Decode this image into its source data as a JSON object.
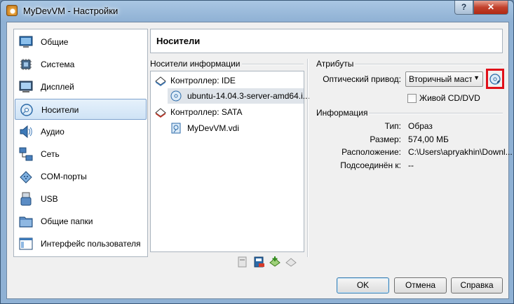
{
  "window": {
    "title": "MyDevVM - Настройки",
    "help_label": "?",
    "close_label": "✕"
  },
  "sidebar": {
    "items": [
      {
        "label": "Общие",
        "icon": "general-icon"
      },
      {
        "label": "Система",
        "icon": "system-icon"
      },
      {
        "label": "Дисплей",
        "icon": "display-icon"
      },
      {
        "label": "Носители",
        "icon": "storage-icon",
        "selected": true
      },
      {
        "label": "Аудио",
        "icon": "audio-icon"
      },
      {
        "label": "Сеть",
        "icon": "network-icon"
      },
      {
        "label": "COM-порты",
        "icon": "serial-ports-icon"
      },
      {
        "label": "USB",
        "icon": "usb-icon"
      },
      {
        "label": "Общие папки",
        "icon": "shared-folders-icon"
      },
      {
        "label": "Интерфейс пользователя",
        "icon": "user-interface-icon"
      }
    ]
  },
  "page": {
    "title": "Носители"
  },
  "storage": {
    "section_title": "Носители информации",
    "tree": [
      {
        "label": "Контроллер: IDE",
        "type": "controller"
      },
      {
        "label": "ubuntu-14.04.3-server-amd64.i...",
        "type": "optical",
        "selected": true
      },
      {
        "label": "Контроллер: SATA",
        "type": "controller"
      },
      {
        "label": "MyDevVM.vdi",
        "type": "disk"
      }
    ]
  },
  "attributes": {
    "section_title": "Атрибуты",
    "drive_label": "Оптический привод:",
    "drive_value": "Вторичный мастер",
    "live_cd_label": "Живой CD/DVD",
    "live_cd_checked": false
  },
  "info": {
    "section_title": "Информация",
    "rows": [
      {
        "label": "Тип:",
        "value": "Образ"
      },
      {
        "label": "Размер:",
        "value": "574,00 МБ"
      },
      {
        "label": "Расположение:",
        "value": "C:\\Users\\apryakhin\\Downl..."
      },
      {
        "label": "Подсоединён к:",
        "value": "--"
      }
    ]
  },
  "buttons": {
    "ok": "OK",
    "cancel": "Отмена",
    "help": "Справка"
  },
  "colors": {
    "accent_red": "#e0101a",
    "selection": "#cfe3f6"
  }
}
